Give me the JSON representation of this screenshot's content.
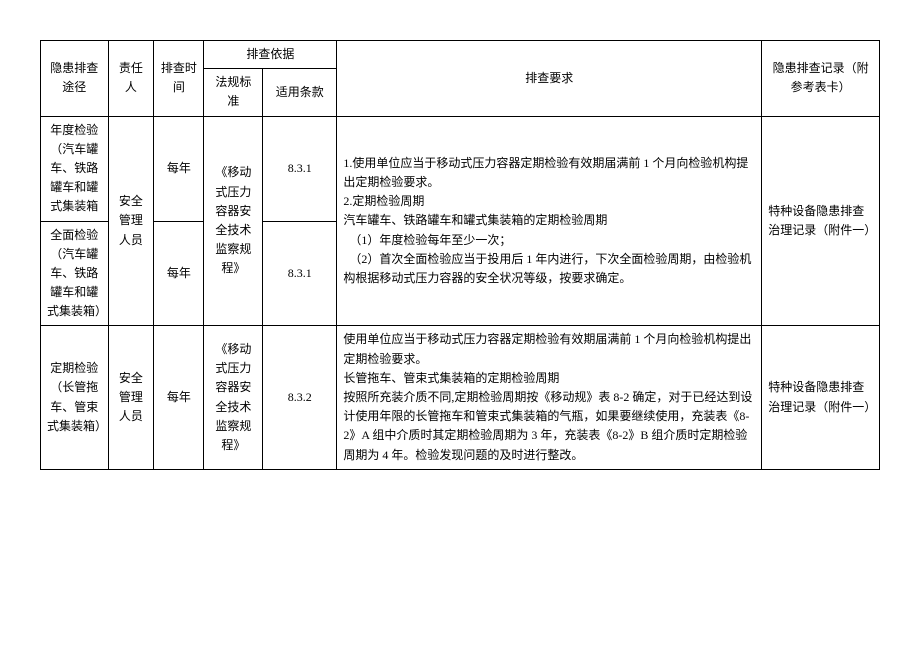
{
  "headers": {
    "route": "隐患排查途径",
    "responsible": "责任人",
    "time": "排查时间",
    "basis_group": "排查依据",
    "basis_standard": "法规标准",
    "basis_clause": "适用条款",
    "requirement": "排查要求",
    "record": "隐患排查记录（附参考表卡）"
  },
  "rows": [
    {
      "route": "年度检验（汽车罐车、铁路罐车和罐式集装箱",
      "responsible": "安全管理人员",
      "time": "每年",
      "basis_standard": "《移动式压力容器安全技术监察规程》",
      "basis_clause": "8.3.1",
      "requirement": "1.使用单位应当于移动式压力容器定期检验有效期届满前 1 个月向检验机构提出定期检验要求。\n2.定期检验周期\n汽车罐车、铁路罐车和罐式集装箱的定期检验周期\n　（1）年度检验每年至少一次；\n　（2）首次全面检验应当于投用后 1 年内进行，下次全面检验周期，由检验机构根据移动式压力容器的安全状况等级，按要求确定。",
      "record": "特种设备隐患排查治理记录（附件一）"
    },
    {
      "route": "全面检验（汽车罐车、铁路罐车和罐式集装箱）",
      "time": "每年",
      "basis_clause": "8.3.1"
    },
    {
      "route": "定期检验（长管拖车、管束式集装箱）",
      "responsible": "安全管理人员",
      "time": "每年",
      "basis_standard": "《移动式压力容器安全技术监察规程》",
      "basis_clause": "8.3.2",
      "requirement": "使用单位应当于移动式压力容器定期检验有效期届满前 1 个月向检验机构提出定期检验要求。\n长管拖车、管束式集装箱的定期检验周期\n按照所充装介质不同,定期检验周期按《移动规》表 8-2 确定，对于已经达到设计使用年限的长管拖车和管束式集装箱的气瓶，如果要继续使用，充装表《8-2》A 组中介质时其定期检验周期为 3 年，充装表《8-2》B 组介质时定期检验周期为 4 年。检验发现问题的及时进行整改。",
      "record": "特种设备隐患排查治理记录（附件一）"
    }
  ]
}
